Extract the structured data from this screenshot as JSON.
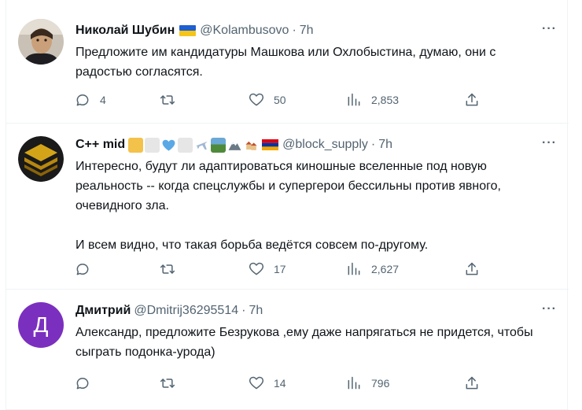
{
  "tweets": [
    {
      "name": "Николай Шубин",
      "handle": "@Kolambusovo",
      "time": "7h",
      "text": "Предложите им кандидатуры Машкова или Охлобыстина, думаю, они с радостью согласятся.",
      "replies": "4",
      "retweets": "",
      "likes": "50",
      "views": "2,853",
      "more": "···"
    },
    {
      "name": "C++ mid",
      "handle": "@block_supply",
      "time": "7h",
      "text": "Интересно, будут ли адаптироваться киношные вселенные под новую реальность -- когда спецслужбы и супергерои бессильны против явного, очевидного зла.\n\nИ всем видно, что такая борьба ведётся совсем по-другому.",
      "replies": "",
      "retweets": "",
      "likes": "17",
      "views": "2,627",
      "more": "···"
    },
    {
      "name": "Дмитрий",
      "handle": "@Dmitrij36295514",
      "time": "7h",
      "avatar_letter": "Д",
      "avatar_color": "#7b2fbf",
      "text": "Александр, предложите Безрукова ,ему даже напрягаться не придется, чтобы сыграть подонка-урода)",
      "replies": "",
      "retweets": "",
      "likes": "14",
      "views": "796",
      "more": "···"
    }
  ],
  "separator": "·",
  "colors": {
    "text": "#0f1419",
    "secondary": "#536471",
    "border": "#eff3f4"
  }
}
